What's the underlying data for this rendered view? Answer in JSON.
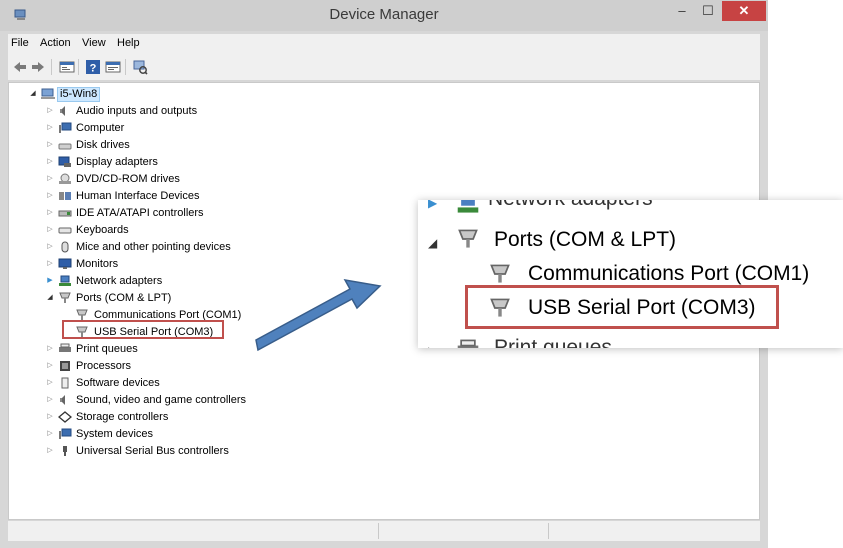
{
  "window": {
    "title": "Device Manager",
    "minimize_glyph": "–",
    "maximize_glyph": "☐",
    "close_glyph": "✕"
  },
  "menu": [
    "File",
    "Action",
    "View",
    "Help"
  ],
  "toolbar": {
    "icons": [
      "back-arrow-icon",
      "forward-arrow-icon",
      "properties-icon",
      "help-icon",
      "show-hidden-icon",
      "scan-hardware-icon"
    ]
  },
  "tree": {
    "root": "i5-Win8",
    "items": [
      {
        "label": "Audio inputs and outputs",
        "icon": "speaker-icon",
        "expanded": false
      },
      {
        "label": "Computer",
        "icon": "computer-icon",
        "expanded": false
      },
      {
        "label": "Disk drives",
        "icon": "disk-drive-icon",
        "expanded": false
      },
      {
        "label": "Display adapters",
        "icon": "display-adapter-icon",
        "expanded": false
      },
      {
        "label": "DVD/CD-ROM drives",
        "icon": "dvd-drive-icon",
        "expanded": false
      },
      {
        "label": "Human Interface Devices",
        "icon": "hid-icon",
        "expanded": false
      },
      {
        "label": "IDE ATA/ATAPI controllers",
        "icon": "ide-controller-icon",
        "expanded": false
      },
      {
        "label": "Keyboards",
        "icon": "keyboard-icon",
        "expanded": false
      },
      {
        "label": "Mice and other pointing devices",
        "icon": "mouse-icon",
        "expanded": false
      },
      {
        "label": "Monitors",
        "icon": "monitor-icon",
        "expanded": false
      },
      {
        "label": "Network adapters",
        "icon": "network-adapter-icon",
        "expanded": false
      },
      {
        "label": "Ports (COM & LPT)",
        "icon": "port-icon",
        "expanded": true,
        "children": [
          {
            "label": "Communications Port (COM1)",
            "icon": "port-icon"
          },
          {
            "label": "USB Serial Port (COM3)",
            "icon": "port-icon",
            "highlighted": true
          }
        ]
      },
      {
        "label": "Print queues",
        "icon": "printer-icon",
        "expanded": false
      },
      {
        "label": "Processors",
        "icon": "processor-icon",
        "expanded": false
      },
      {
        "label": "Software devices",
        "icon": "software-device-icon",
        "expanded": false
      },
      {
        "label": "Sound, video and game controllers",
        "icon": "speaker-icon",
        "expanded": false
      },
      {
        "label": "Storage controllers",
        "icon": "storage-controller-icon",
        "expanded": false
      },
      {
        "label": "System devices",
        "icon": "system-device-icon",
        "expanded": false
      },
      {
        "label": "Universal Serial Bus controllers",
        "icon": "usb-icon",
        "expanded": false
      }
    ]
  },
  "zoom": {
    "partial_top": "Network adapters",
    "ports": "Ports (COM & LPT)",
    "com1": "Communications Port (COM1)",
    "com3": "USB Serial Port (COM3)",
    "partial_bottom": "Print queues"
  },
  "colors": {
    "highlight_border": "#c0504d",
    "arrow_fill": "#4f81bd",
    "close_button": "#c74343"
  }
}
